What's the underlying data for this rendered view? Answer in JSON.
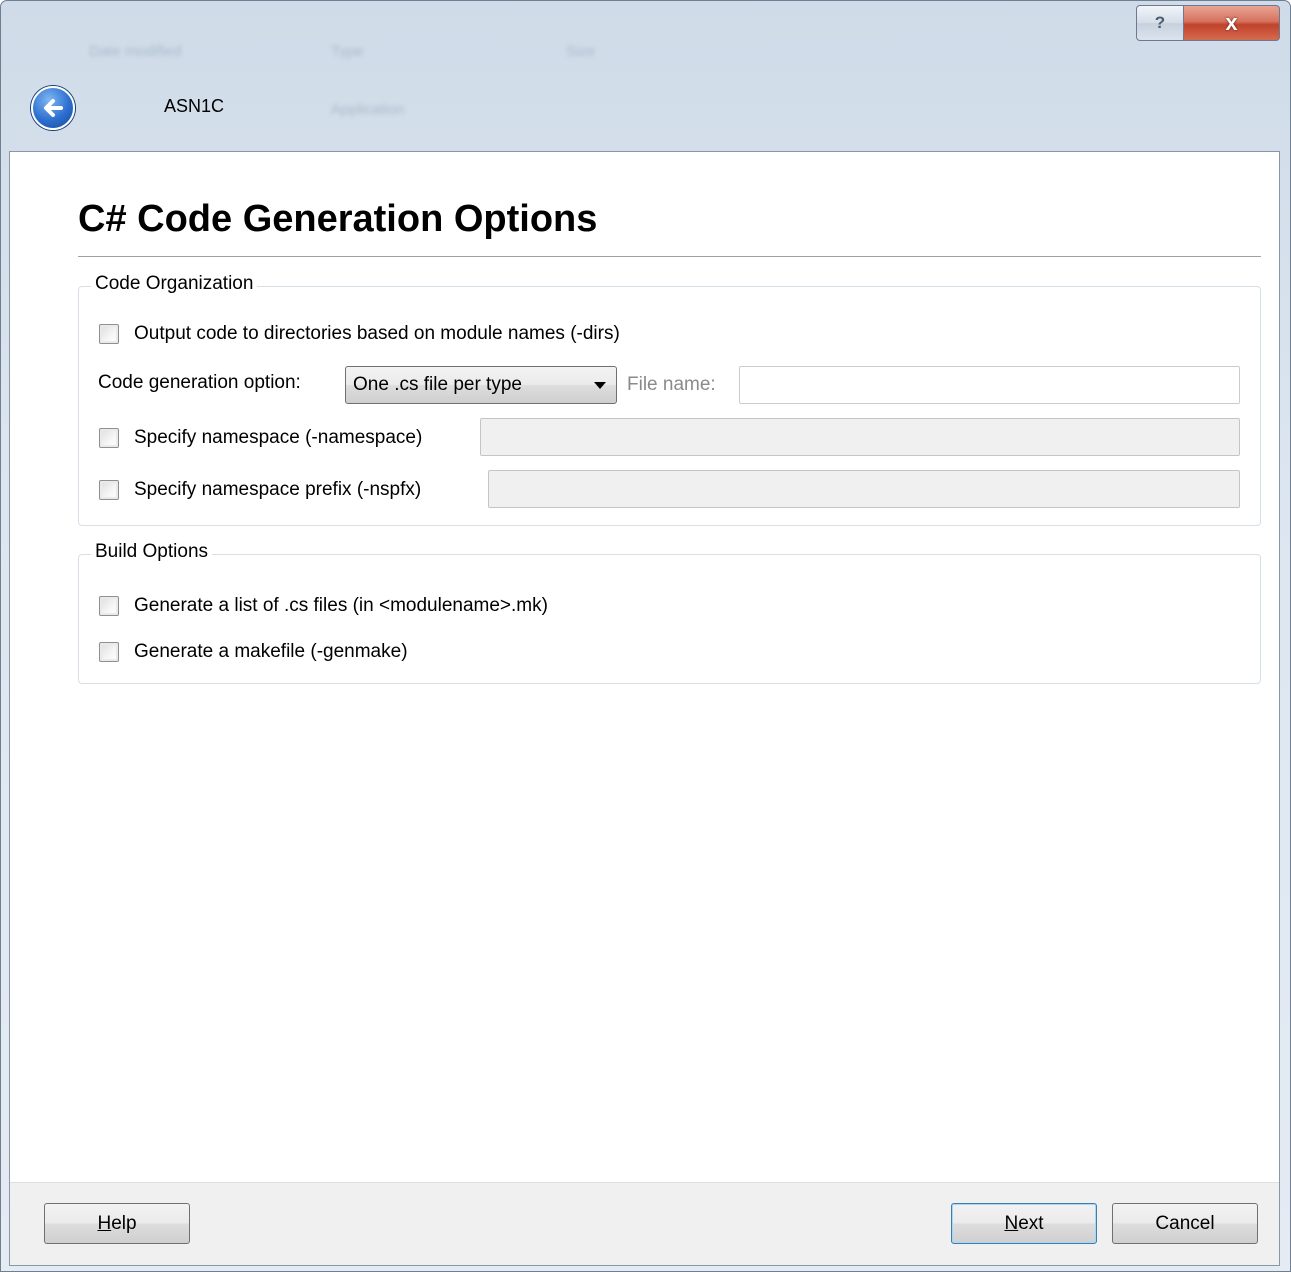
{
  "window": {
    "title": "ASN1C",
    "help_caption": "?",
    "close_caption": "x"
  },
  "page": {
    "title": "C# Code Generation Options"
  },
  "code_organization": {
    "legend": "Code Organization",
    "dirs_label": "Output code to directories based on module names (-dirs)",
    "codegen_label": "Code generation option:",
    "codegen_value": "One .cs file per type",
    "file_name_label": "File name:",
    "file_name_value": "",
    "namespace_label": "Specify namespace (-namespace)",
    "namespace_value": "",
    "nspfx_label": "Specify namespace prefix (-nspfx)",
    "nspfx_value": ""
  },
  "build_options": {
    "legend": "Build Options",
    "list_label": "Generate a list of .cs files (in <modulename>.mk)",
    "makefile_label": "Generate a makefile (-genmake)"
  },
  "footer": {
    "help_accel": "H",
    "help_rest": "elp",
    "next_accel": "N",
    "next_rest": "ext",
    "cancel_label": "Cancel"
  }
}
